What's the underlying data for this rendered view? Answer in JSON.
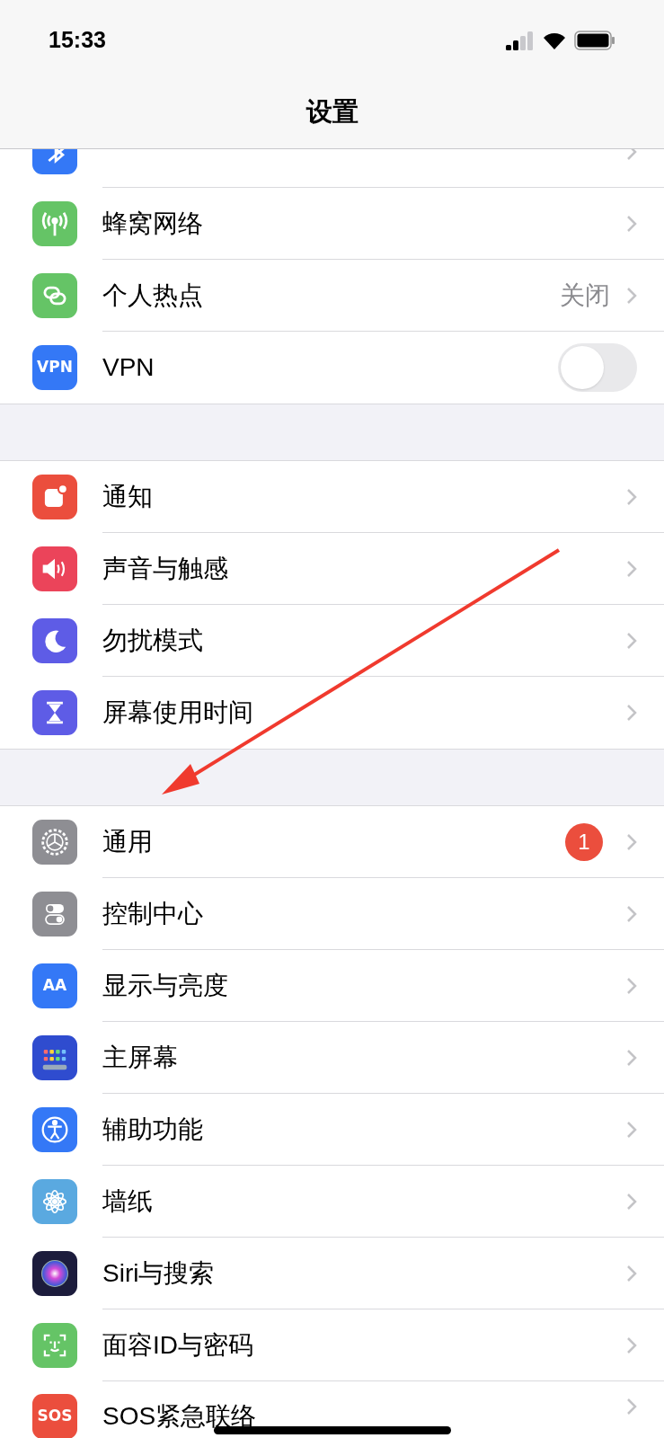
{
  "status_bar": {
    "time": "15:33"
  },
  "nav": {
    "title": "设置"
  },
  "sections": [
    {
      "rows": [
        {
          "kind": "chevron",
          "color": "#3478f6"
        },
        {
          "label": "蜂窝网络",
          "kind": "chevron",
          "color": "#65c466"
        },
        {
          "label": "个人热点",
          "value": "关闭",
          "kind": "chevron",
          "color": "#65c466"
        },
        {
          "label": "VPN",
          "kind": "toggle",
          "on": false,
          "icon_text": "VPN",
          "color": "#3478f6"
        }
      ]
    },
    {
      "rows": [
        {
          "label": "通知",
          "kind": "chevron",
          "color": "#eb4e3d"
        },
        {
          "label": "声音与触感",
          "kind": "chevron",
          "color": "#eb445a"
        },
        {
          "label": "勿扰模式",
          "kind": "chevron",
          "color": "#5e5ce6"
        },
        {
          "label": "屏幕使用时间",
          "kind": "chevron",
          "color": "#5e5ce6"
        }
      ]
    },
    {
      "rows": [
        {
          "label": "通用",
          "kind": "chevron",
          "badge": "1",
          "color": "#8e8e93"
        },
        {
          "label": "控制中心",
          "kind": "chevron",
          "color": "#8e8e93"
        },
        {
          "label": "显示与亮度",
          "kind": "chevron",
          "icon_text": "AA",
          "color": "#3478f6"
        },
        {
          "label": "主屏幕",
          "kind": "chevron",
          "color": "#2f4ccf"
        },
        {
          "label": "辅助功能",
          "kind": "chevron",
          "color": "#3478f6"
        },
        {
          "label": "墙纸",
          "kind": "chevron",
          "color": "#5aa9e0"
        },
        {
          "label": "Siri与搜索",
          "kind": "chevron",
          "color": "#1c1c3c"
        },
        {
          "label": "面容ID与密码",
          "kind": "chevron",
          "color": "#65c466"
        },
        {
          "label": "SOS紧急联络",
          "kind": "chevron",
          "icon_text": "SOS",
          "color": "#eb4e3d"
        }
      ]
    }
  ]
}
